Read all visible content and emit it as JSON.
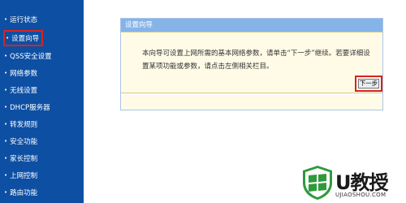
{
  "sidebar": {
    "items": [
      {
        "label": "运行状态"
      },
      {
        "label": "设置向导"
      },
      {
        "label": "QSS安全设置"
      },
      {
        "label": "网络参数"
      },
      {
        "label": "无线设置"
      },
      {
        "label": "DHCP服务器"
      },
      {
        "label": "转发规则"
      },
      {
        "label": "安全功能"
      },
      {
        "label": "家长控制"
      },
      {
        "label": "上网控制"
      },
      {
        "label": "路由功能"
      }
    ],
    "bullet": "•",
    "active_index": 1
  },
  "wizard": {
    "title": "设置向导",
    "description": "本向导可设置上网所需的基本网络参数，请单击“下一步”继续。若要详细设置某项功能或参数，请点击左侧相关栏目。",
    "next_label": "下一步"
  },
  "watermark": {
    "brand": "U教授",
    "domain": "UJIAOSHOU.COM"
  },
  "colors": {
    "sidebar_bg": "#0d4fa3",
    "panel_header_bg": "#86b4e8",
    "panel_body_bg": "#fffbe7",
    "highlight_red": "#d9231e",
    "logo_green": "#2f9a3c"
  }
}
